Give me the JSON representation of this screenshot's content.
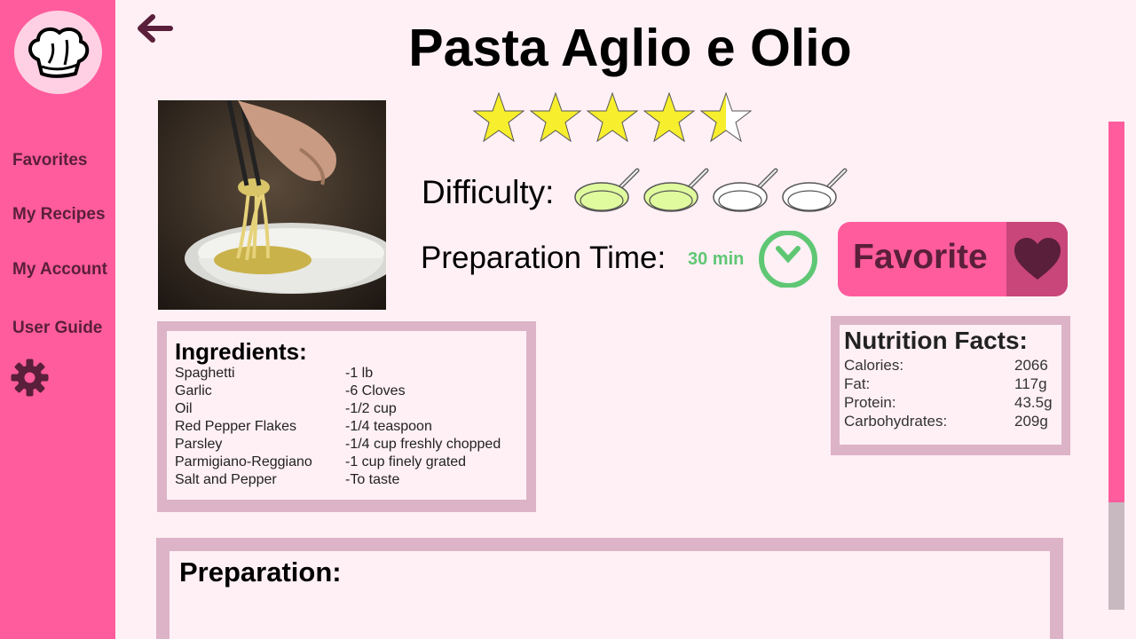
{
  "sidebar": {
    "items": [
      {
        "label": "Favorites"
      },
      {
        "label": "My Recipes"
      },
      {
        "label": "My Account"
      },
      {
        "label": "User Guide"
      }
    ]
  },
  "recipe": {
    "title": "Pasta Aglio e Olio",
    "rating": 4.5,
    "rating_max": 5,
    "difficulty_label": "Difficulty:",
    "difficulty": 2,
    "difficulty_max": 4,
    "prep_time_label": "Preparation Time:",
    "prep_time_value": "30 min"
  },
  "favorite": {
    "label": "Favorite"
  },
  "ingredients": {
    "title": "Ingredients:",
    "items": [
      {
        "name": "Spaghetti",
        "amount": "-1 lb"
      },
      {
        "name": "Garlic",
        "amount": "-6 Cloves"
      },
      {
        "name": "Oil",
        "amount": "-1/2 cup"
      },
      {
        "name": "Red Pepper Flakes",
        "amount": "-1/4 teaspoon"
      },
      {
        "name": "Parsley",
        "amount": "-1/4 cup freshly chopped"
      },
      {
        "name": "Parmigiano-Reggiano",
        "amount": "-1 cup finely grated"
      },
      {
        "name": "Salt and Pepper",
        "amount": "-To taste"
      }
    ]
  },
  "nutrition": {
    "title": "Nutrition Facts:",
    "items": [
      {
        "label": "Calories:",
        "value": "2066"
      },
      {
        "label": "Fat:",
        "value": "117g"
      },
      {
        "label": "Protein:",
        "value": "43.5g"
      },
      {
        "label": "Carbohydrates:",
        "value": "209g"
      }
    ]
  },
  "preparation": {
    "title": "Preparation:"
  },
  "scroll": {
    "position_fraction": 0.0,
    "visible_fraction": 0.78
  },
  "colors": {
    "sidebar": "#ff5c9d",
    "accent_dark": "#5a1f3a",
    "background": "#fff0f5",
    "box_border": "#dcb3c7",
    "star": "#f7ee2e",
    "pan_fill": "#e0fb9e",
    "clock": "#5fc774"
  },
  "icons": {
    "logo": "chef-hat-icon",
    "settings": "gear-icon",
    "back": "back-arrow-icon",
    "favorite": "heart-icon",
    "time": "clock-icon",
    "rating": "star-icon",
    "difficulty": "frying-pan-icon"
  }
}
